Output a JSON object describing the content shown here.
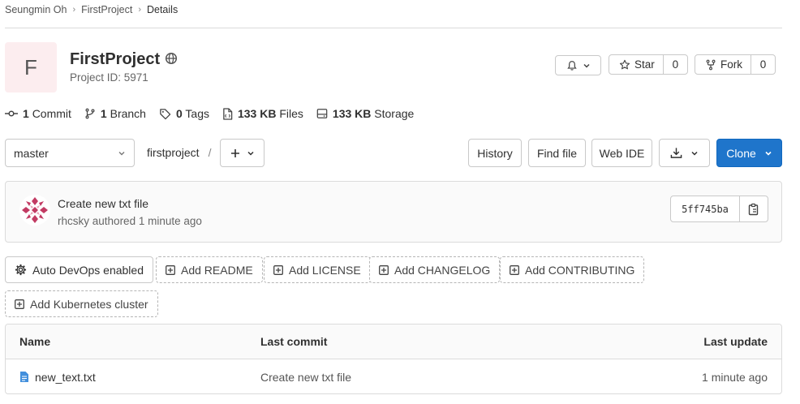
{
  "breadcrumb": {
    "user": "Seungmin Oh",
    "project": "FirstProject",
    "current": "Details"
  },
  "project": {
    "avatar_letter": "F",
    "name": "FirstProject",
    "id_text": "Project ID: 5971"
  },
  "actions": {
    "star_label": "Star",
    "star_count": "0",
    "fork_label": "Fork",
    "fork_count": "0"
  },
  "stats": {
    "commits_count": "1",
    "commits_label": "Commit",
    "branches_count": "1",
    "branches_label": "Branch",
    "tags_count": "0",
    "tags_label": "Tags",
    "files_size": "133 KB",
    "files_label": "Files",
    "storage_size": "133 KB",
    "storage_label": "Storage"
  },
  "toolbar": {
    "branch": "master",
    "path": "firstproject",
    "path_sep": "/",
    "history": "History",
    "find_file": "Find file",
    "web_ide": "Web IDE",
    "clone": "Clone"
  },
  "last_commit": {
    "title": "Create new txt file",
    "author": "rhcsky",
    "meta_rest": "authored 1 minute ago",
    "sha": "5ff745ba"
  },
  "quick_actions": [
    "Auto DevOps enabled",
    "Add README",
    "Add LICENSE",
    "Add CHANGELOG",
    "Add CONTRIBUTING",
    "Add Kubernetes cluster"
  ],
  "table": {
    "headers": {
      "name": "Name",
      "last_commit": "Last commit",
      "last_update": "Last update"
    },
    "rows": [
      {
        "name": "new_text.txt",
        "last_commit": "Create new txt file",
        "last_update": "1 minute ago"
      }
    ]
  },
  "icons": {
    "globe": "globe-icon",
    "bell": "bell-icon",
    "star": "star-icon",
    "fork": "fork-icon",
    "commit": "commit-icon",
    "branch": "branch-icon",
    "tag": "tag-icon",
    "file": "file-icon",
    "storage": "storage-icon",
    "plus": "plus-icon",
    "download": "download-icon",
    "copy": "copy-icon",
    "gear": "gear-icon",
    "plus-square": "plus-square-icon"
  },
  "colors": {
    "primary": "#1f75cb",
    "avatar_bg": "#fcedef",
    "file_icon": "#428fdc",
    "identicon": "#c23b63"
  }
}
